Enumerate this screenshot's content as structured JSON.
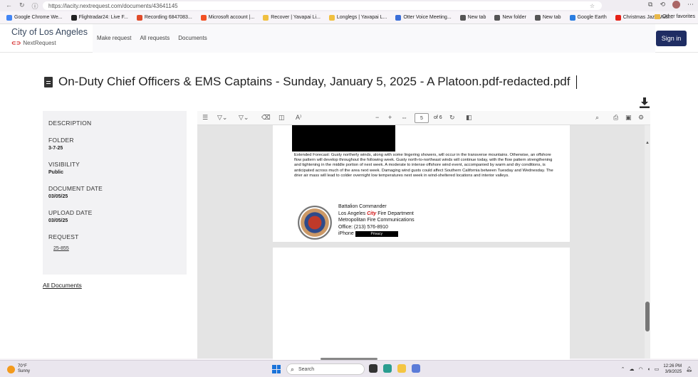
{
  "browser": {
    "url": "https://lacity.nextrequest.com/documents/43641145",
    "bookmarks": [
      {
        "label": "Google Chrome We...",
        "color": "#4285f4"
      },
      {
        "label": "Flightradar24: Live F...",
        "color": "#222222"
      },
      {
        "label": "Recording 6847083...",
        "color": "#e04b2a"
      },
      {
        "label": "Microsoft account |...",
        "color": "#f25022"
      },
      {
        "label": "Recover | Yavapai Li...",
        "color": "#f0c040"
      },
      {
        "label": "Longlegs | Yavapai L...",
        "color": "#f0c040"
      },
      {
        "label": "Otter Voice Meeting...",
        "color": "#3b6fd8"
      },
      {
        "label": "New tab",
        "color": "#555555"
      },
      {
        "label": "New folder",
        "color": "#555555"
      },
      {
        "label": "New tab",
        "color": "#555555"
      },
      {
        "label": "Google Earth",
        "color": "#2a7de1"
      },
      {
        "label": "Christmas Jazz Musi...",
        "color": "#e62117"
      }
    ],
    "other_favorites": "Other favorites"
  },
  "site": {
    "title": "City of Los Angeles",
    "brand": "NextRequest",
    "nav": [
      "Make request",
      "All requests",
      "Documents"
    ],
    "signin": "Sign in"
  },
  "document": {
    "title": "On-Duty Chief Officers & EMS Captains - Sunday, January 5, 2025 - A Platoon.pdf-redacted.pdf"
  },
  "sidebar": {
    "description_label": "DESCRIPTION",
    "folder_label": "FOLDER",
    "folder_value": "3-7-25",
    "visibility_label": "VISIBILITY",
    "visibility_value": "Public",
    "document_date_label": "DOCUMENT DATE",
    "document_date_value": "03/05/25",
    "upload_date_label": "UPLOAD DATE",
    "upload_date_value": "03/05/25",
    "request_label": "REQUEST",
    "request_value": "25-855",
    "all_documents": "All Documents"
  },
  "viewer": {
    "page_current": "5",
    "page_total": "of 6",
    "forecast": "Extended Forecast: Gusty northerly winds, along with some lingering showers, will occur in the transverse mountains. Otherwise, an offshore flow pattern will develop throughout the following week. Gusty north-to-northeast winds will continue today, with the flow pattern strengthening and tightening in the middle portion of next week. A moderate to intense offshore wind event, accompanied by warm and dry conditions, is anticipated across much of the area next week. Damaging wind gusts could affect Southern California between Tuesday and Wednesday. The drier air mass will lead to colder overnight low temperatures next week in wind-sheltered locations and interior valleys.",
    "sig_line1": "Battalion Commander",
    "sig_line2_a": "Los Angeles ",
    "sig_line2_city": "City",
    "sig_line2_b": " Fire Department",
    "sig_line3": "Metropolitan Fire Communications",
    "sig_line4": "Office: (213) 576-8910",
    "sig_line5": "iPhone",
    "redaction_label": "Privacy"
  },
  "taskbar": {
    "temp": "70°F",
    "condition": "Sunny",
    "search": "Search",
    "time": "12:26 PM",
    "date": "3/9/2025"
  }
}
